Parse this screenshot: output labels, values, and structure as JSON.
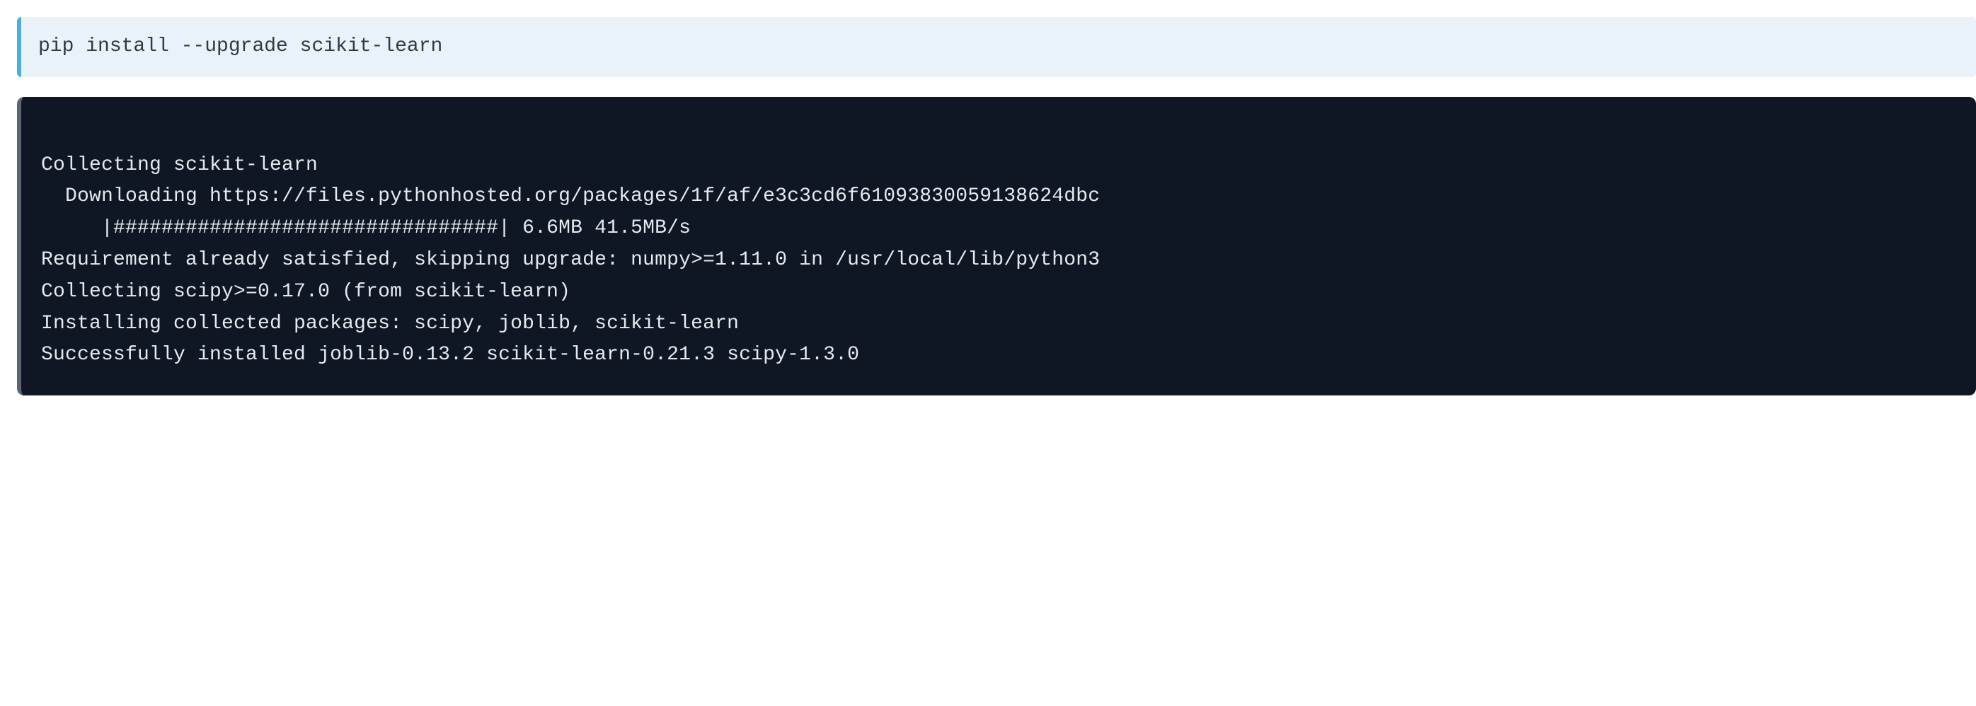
{
  "input_cell": {
    "code": "pip install --upgrade scikit-learn"
  },
  "output_cell": {
    "lines": [
      "Collecting scikit-learn",
      "  Downloading https://files.pythonhosted.org/packages/1f/af/e3c3cd6f61093830059138624dbc",
      "     |################################| 6.6MB 41.5MB/s ",
      "Requirement already satisfied, skipping upgrade: numpy>=1.11.0 in /usr/local/lib/python3",
      "Collecting scipy>=0.17.0 (from scikit-learn)",
      "Installing collected packages: scipy, joblib, scikit-learn",
      "Successfully installed joblib-0.13.2 scikit-learn-0.21.3 scipy-1.3.0"
    ]
  }
}
